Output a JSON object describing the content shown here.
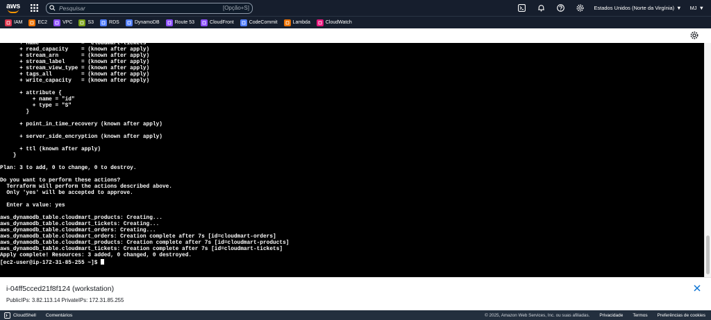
{
  "nav": {
    "logo": "aws",
    "search_placeholder": "Pesquisar",
    "search_shortcut": "[Opção+S]",
    "region": "Estados Unidos (Norte da Virgínia)",
    "account": "MJ"
  },
  "favorites": [
    {
      "label": "IAM",
      "color": "#dd344c"
    },
    {
      "label": "EC2",
      "color": "#ed7100"
    },
    {
      "label": "VPC",
      "color": "#8c4fff"
    },
    {
      "label": "S3",
      "color": "#7aa116"
    },
    {
      "label": "RDS",
      "color": "#527fff"
    },
    {
      "label": "DynamoDB",
      "color": "#527fff"
    },
    {
      "label": "Route 53",
      "color": "#8c4fff"
    },
    {
      "label": "CloudFront",
      "color": "#8c4fff"
    },
    {
      "label": "CodeCommit",
      "color": "#527fff"
    },
    {
      "label": "Lambda",
      "color": "#ed7100"
    },
    {
      "label": "CloudWatch",
      "color": "#e7157b"
    }
  ],
  "terminal": {
    "lines_top": "      + name             = \"cloudmart-tickets\"\n      + read_capacity    = (known after apply)\n      + stream_arn       = (known after apply)\n      + stream_label     = (known after apply)\n      + stream_view_type = (known after apply)\n      + tags_all         = (known after apply)\n      + write_capacity   = (known after apply)\n\n      + attribute {\n          + name = \"id\"\n          + type = \"S\"\n        }\n\n      + point_in_time_recovery (known after apply)\n\n      + server_side_encryption (known after apply)\n\n      + ttl (known after apply)\n    }\n\nPlan: 3 to add, 0 to change, 0 to destroy.\n\nDo you want to perform these actions?\n  Terraform will perform the actions described above.\n  Only 'yes' will be accepted to approve.\n\n  Enter a value: yes\n\naws_dynamodb_table.cloudmart_products: Creating...\naws_dynamodb_table.cloudmart_tickets: Creating...\naws_dynamodb_table.cloudmart_orders: Creating...\naws_dynamodb_table.cloudmart_orders: Creation complete after 7s [id=cloudmart-orders]\naws_dynamodb_table.cloudmart_products: Creation complete after 7s [id=cloudmart-products]\naws_dynamodb_table.cloudmart_tickets: Creation complete after 7s [id=cloudmart-tickets]\n",
    "apply_complete": "Apply complete! Resources: 3 added, 0 changed, 0 destroyed.",
    "prompt": "[ec2-user@ip-172-31-85-255 ~]$ "
  },
  "instance": {
    "id": "i-04ff5cced21f8f124 (workstation)",
    "ips": "PublicIPs: 3.82.113.14    PrivateIPs: 172.31.85.255"
  },
  "footer": {
    "cloudshell": "CloudShell",
    "comments": "Comentários",
    "copyright": "© 2025, Amazon Web Services, Inc. ou suas afiliadas.",
    "privacy": "Privacidade",
    "terms": "Termos",
    "cookies": "Preferências de cookies"
  }
}
